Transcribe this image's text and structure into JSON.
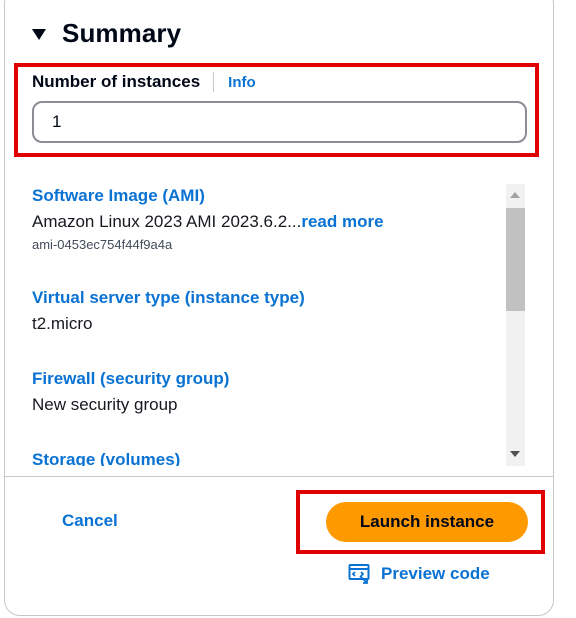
{
  "summary": {
    "title": "Summary",
    "caret_icon": "caret-down-icon"
  },
  "instances_field": {
    "label": "Number of instances",
    "info_label": "Info",
    "value": "1"
  },
  "details": [
    {
      "title": "Software Image (AMI)",
      "value": "Amazon Linux 2023 AMI 2023.6.2...",
      "read_more": "read more",
      "sub": "ami-0453ec754f44f9a4a"
    },
    {
      "title": "Virtual server type (instance type)",
      "value": "t2.micro"
    },
    {
      "title": "Firewall (security group)",
      "value": "New security group"
    },
    {
      "title": "Storage (volumes)"
    }
  ],
  "footer": {
    "cancel_label": "Cancel",
    "launch_label": "Launch instance",
    "preview_label": "Preview code",
    "preview_icon": "code-preview-icon"
  },
  "colors": {
    "link": "#0972d3",
    "primary_button": "#ff9900",
    "highlight": "#e00000"
  }
}
